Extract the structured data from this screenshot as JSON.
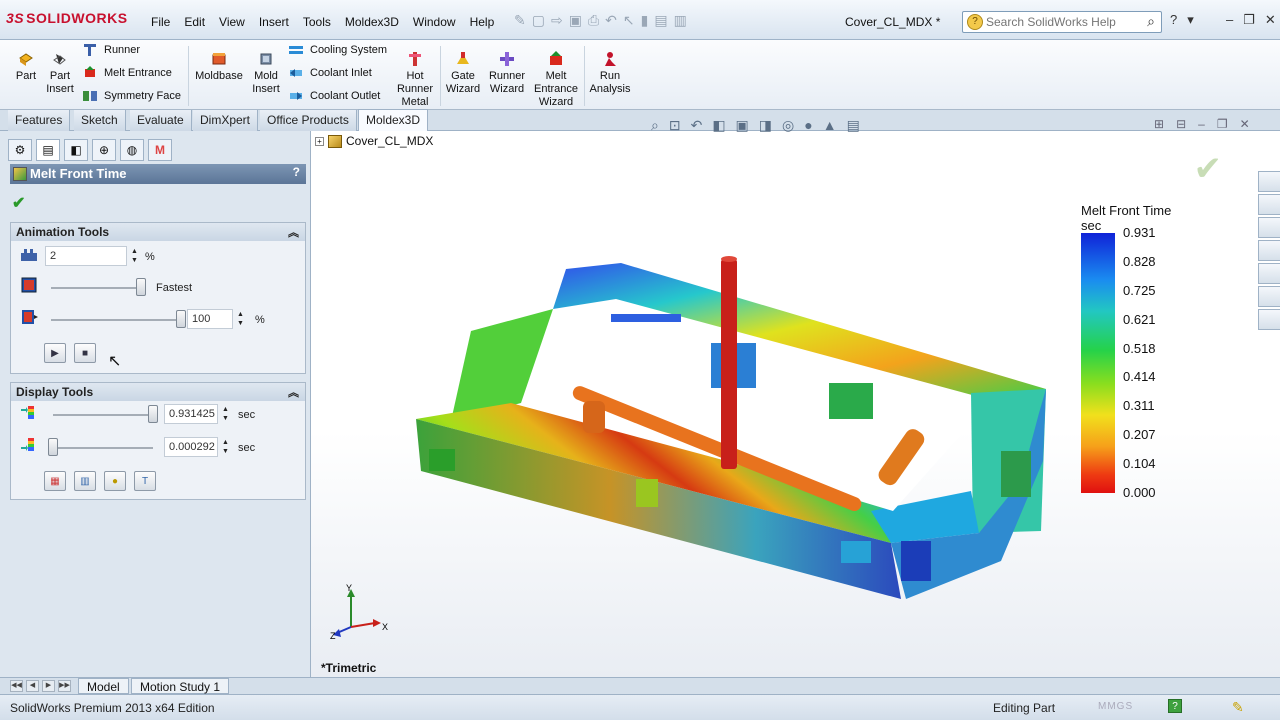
{
  "app": {
    "brand": "SOLIDWORKS",
    "document_title": "Cover_CL_MDX *"
  },
  "menu": [
    "File",
    "Edit",
    "View",
    "Insert",
    "Tools",
    "Moldex3D",
    "Window",
    "Help"
  ],
  "search": {
    "placeholder": "Search SolidWorks Help"
  },
  "ribbon": {
    "part": "Part",
    "part_insert": [
      "Part",
      "Insert"
    ],
    "runner": "Runner",
    "melt_entrance": "Melt Entrance",
    "symmetry_face": "Symmetry Face",
    "moldbase": "Moldbase",
    "mold_insert": [
      "Mold",
      "Insert"
    ],
    "cooling_system": "Cooling System",
    "coolant_inlet": "Coolant Inlet",
    "coolant_outlet": "Coolant Outlet",
    "hot_runner_metal": [
      "Hot",
      "Runner",
      "Metal"
    ],
    "gate_wizard": [
      "Gate",
      "Wizard"
    ],
    "runner_wizard": [
      "Runner",
      "Wizard"
    ],
    "melt_entrance_wizard": [
      "Melt",
      "Entrance",
      "Wizard"
    ],
    "run_analysis": [
      "Run",
      "Analysis"
    ]
  },
  "command_tabs": [
    "Features",
    "Sketch",
    "Evaluate",
    "DimXpert",
    "Office Products",
    "Moldex3D"
  ],
  "active_command_tab": "Moldex3D",
  "property_manager": {
    "title": "Melt Front Time",
    "help": "?",
    "animation_tools": {
      "heading": "Animation Tools",
      "step_value": "2",
      "step_unit": "%",
      "speed_label": "Fastest",
      "speed_level_fraction": 1.0,
      "progress_value": "100",
      "progress_unit": "%",
      "progress_level_fraction": 1.0
    },
    "display_tools": {
      "heading": "Display Tools",
      "max_value": "0.931425",
      "max_unit": "sec",
      "max_level_fraction": 1.0,
      "min_value": "0.000292",
      "min_unit": "sec",
      "min_level_fraction": 0.0
    }
  },
  "model_tree": {
    "root": "Cover_CL_MDX"
  },
  "view": {
    "orientation": "*Trimetric",
    "axis_x": "X",
    "axis_y": "Y",
    "axis_z": "Z"
  },
  "legend": {
    "title": "Melt Front Time",
    "unit": "sec",
    "values": [
      "0.931",
      "0.828",
      "0.725",
      "0.621",
      "0.518",
      "0.414",
      "0.311",
      "0.207",
      "0.104",
      "0.000"
    ],
    "colors": {
      "max": "#1023d8",
      "mid": "#25d24a",
      "min": "#e01010"
    }
  },
  "bottom_tabs": [
    "Model",
    "Motion Study 1"
  ],
  "status": {
    "edition": "SolidWorks Premium 2013 x64 Edition",
    "mode": "Editing Part",
    "units": "MMGS"
  },
  "icons": [
    "search-icon",
    "help-icon",
    "play-icon",
    "stop-icon",
    "check-icon",
    "part-icon"
  ]
}
